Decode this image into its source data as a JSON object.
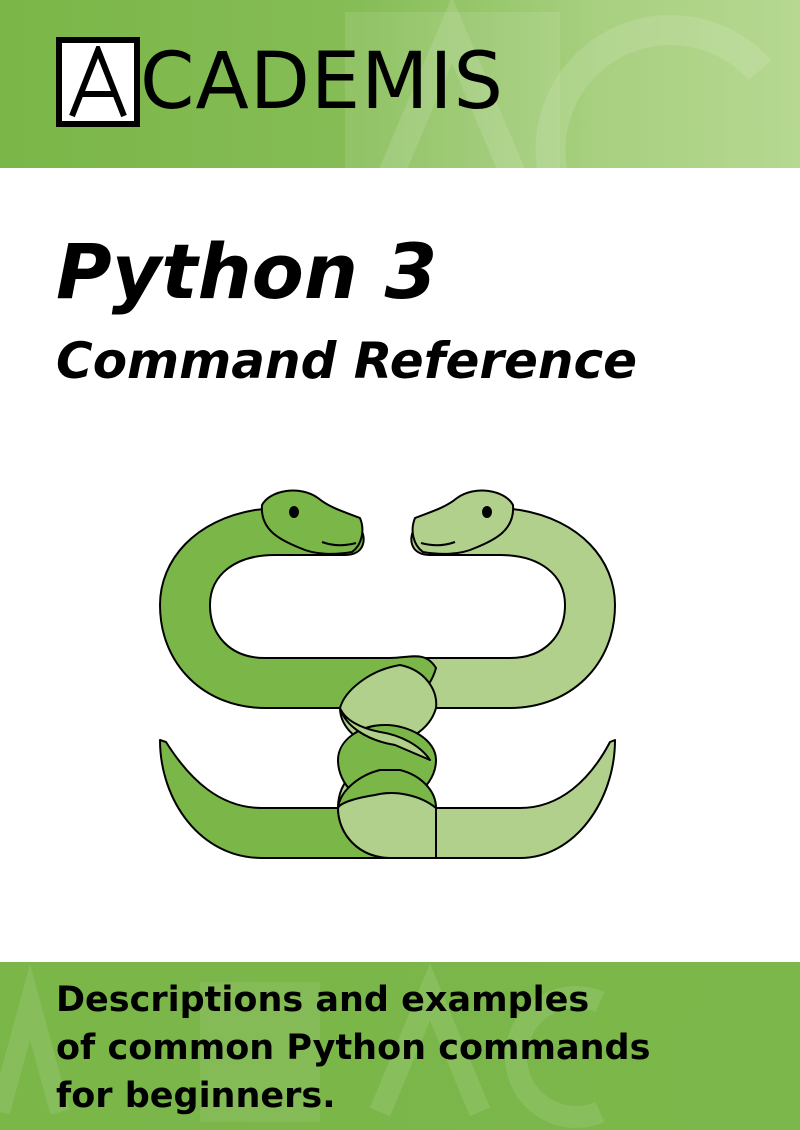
{
  "header": {
    "logo_text": "CADEMIS",
    "logo_letter": "A",
    "banner_color": "#7ab648",
    "banner_color_light": "#b6d891"
  },
  "cover": {
    "title": "Python 3",
    "subtitle": "Command Reference",
    "illustration": "two-intertwined-snakes",
    "snake_dark_color": "#7ab648",
    "snake_light_color": "#b0d08c"
  },
  "footer": {
    "description": "Descriptions and examples\nof common Python commands\nfor beginners."
  }
}
